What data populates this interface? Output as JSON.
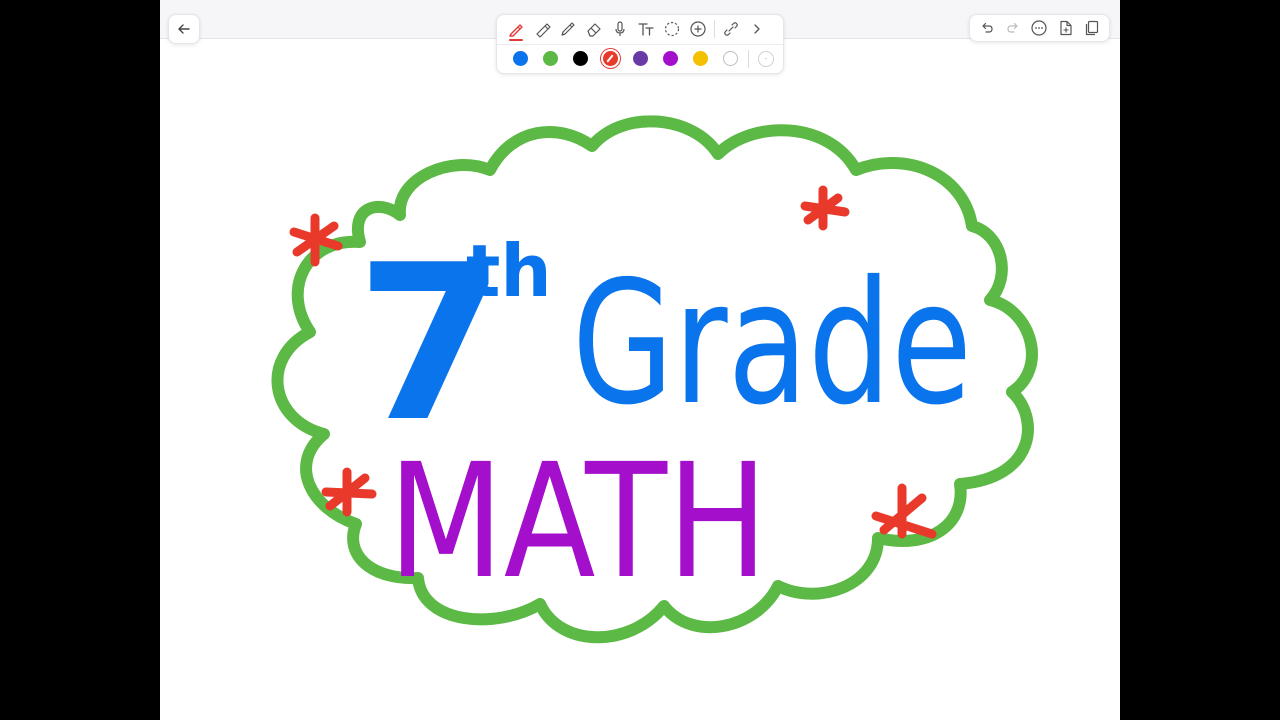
{
  "drawing": {
    "line1_main": "7",
    "line1_sup": "th",
    "line1_word": "Grade",
    "line2": "MATH"
  },
  "colors": {
    "cloud": "#5cb946",
    "title_blue": "#0a74ec",
    "math_purple": "#a40fcb",
    "stars_red": "#e8392a"
  },
  "toolbar": {
    "tools": [
      "pen-icon",
      "highlighter-icon",
      "pencil-icon",
      "eraser-icon",
      "microphone-icon",
      "text-icon",
      "lasso-icon",
      "add-icon",
      "link-icon",
      "chevron-right-icon"
    ],
    "active_tool": "pen",
    "palette": [
      "#0a74ec",
      "#5cb946",
      "#000000",
      "#e8392a",
      "#6a3aa6",
      "#a40fcb",
      "#f3c100",
      "#ffffff"
    ],
    "selected_color": "#e8392a"
  },
  "right_toolbar": {
    "icons": [
      "undo-icon",
      "redo-icon",
      "more-icon",
      "add-page-icon",
      "pages-icon"
    ]
  }
}
